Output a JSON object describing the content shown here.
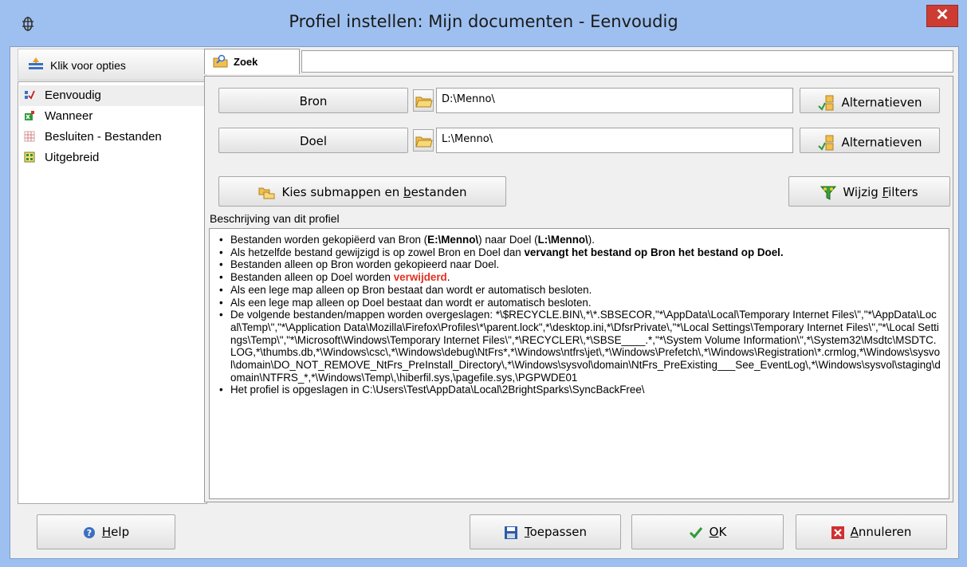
{
  "window": {
    "title": "Profiel instellen: Mijn documenten - Eenvoudig",
    "close_label": "✕"
  },
  "sidebar": {
    "options_label": "Klik voor opties",
    "items": [
      {
        "label": "Eenvoudig",
        "selected": true,
        "icon": "simple-profile-icon"
      },
      {
        "label": "Wanneer",
        "selected": false,
        "icon": "schedule-icon"
      },
      {
        "label": "Besluiten - Bestanden",
        "selected": false,
        "icon": "decisions-files-icon"
      },
      {
        "label": "Uitgebreid",
        "selected": false,
        "icon": "advanced-grid-icon"
      }
    ]
  },
  "search": {
    "tab_label": "Zoek",
    "value": ""
  },
  "source": {
    "button_label": "Bron",
    "path": "D:\\Menno\\",
    "alternatives_label": "Alternatieven"
  },
  "destination": {
    "button_label": "Doel",
    "path": "L:\\Menno\\",
    "alternatives_label": "Alternatieven"
  },
  "actions": {
    "subfolders_pre": "Kies submappen en ",
    "subfolders_ul": "b",
    "subfolders_post": "estanden",
    "filters_pre": "Wijzig ",
    "filters_ul": "F",
    "filters_post": "ilters"
  },
  "description": {
    "label": "Beschrijving van dit profiel",
    "line1_pre": "Bestanden worden gekopiëerd van Bron (",
    "line1_src": "E:\\Menno\\",
    "line1_mid": ") naar Doel (",
    "line1_dst": "L:\\Menno\\",
    "line1_post": ").",
    "line2_pre": "Als hetzelfde bestand gewijzigd is op zowel Bron en Doel dan ",
    "line2_bold": "vervangt het bestand op Bron het bestand op Doel.",
    "line3": "Bestanden alleen op Bron worden gekopieerd naar Doel.",
    "line4_pre": "Bestanden alleen op Doel worden ",
    "line4_red": "verwijderd",
    "line4_post": ".",
    "line5": "Als een lege map alleen op Bron bestaat dan wordt er automatisch besloten.",
    "line6": "Als een lege map alleen op Doel bestaat dan wordt er automatisch besloten.",
    "line7": "De volgende bestanden/mappen worden overgeslagen: *\\$RECYCLE.BIN\\,*\\*.SBSECOR,\"*\\AppData\\Local\\Temporary Internet Files\\\",\"*\\AppData\\Local\\Temp\\\",\"*\\Application Data\\Mozilla\\Firefox\\Profiles\\*\\parent.lock\",*\\desktop.ini,*\\DfsrPrivate\\,\"*\\Local Settings\\Temporary Internet Files\\\",\"*\\Local Settings\\Temp\\\",\"*\\Microsoft\\Windows\\Temporary Internet Files\\\",*\\RECYCLER\\,*\\SBSE____.*,\"*\\System Volume Information\\\",*\\System32\\Msdtc\\MSDTC.LOG,*\\thumbs.db,*\\Windows\\csc\\,*\\Windows\\debug\\NtFrs*,*\\Windows\\ntfrs\\jet\\,*\\Windows\\Prefetch\\,*\\Windows\\Registration\\*.crmlog,*\\Windows\\sysvol\\domain\\DO_NOT_REMOVE_NtFrs_PreInstall_Directory\\,*\\Windows\\sysvol\\domain\\NtFrs_PreExisting___See_EventLog\\,*\\Windows\\sysvol\\staging\\domain\\NTFRS_*,*\\Windows\\Temp\\,\\hiberfil.sys,\\pagefile.sys,\\PGPWDE01",
    "line8": "Het profiel is opgeslagen in C:\\Users\\Test\\AppData\\Local\\2BrightSparks\\SyncBackFree\\"
  },
  "footer": {
    "help_ul": "H",
    "help_post": "elp",
    "apply_ul": "T",
    "apply_post": "oepassen",
    "ok_ul": "O",
    "ok_post": "K",
    "cancel_ul": "A",
    "cancel_post": "nnuleren"
  },
  "colors": {
    "title_bg": "#9ec0f0",
    "close_bg": "#cc3c33",
    "red_text": "#e03020"
  }
}
